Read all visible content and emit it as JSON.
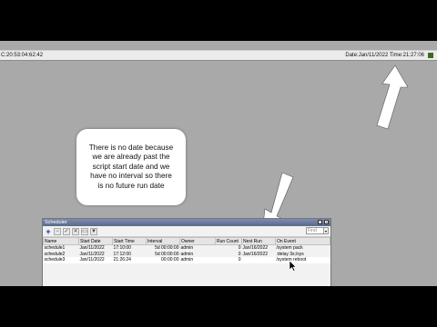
{
  "statusbar": {
    "mac": "C:20:53:04:62:42",
    "date_time": "Date:Jan/11/2022  Time:21:27:06",
    "indicator_color": "#3d6b21"
  },
  "annotation": {
    "text": "There is no date because\nwe are already past the\nscript start date and we\nhave no interval so there\nis no future run date"
  },
  "scheduler": {
    "title": "Scheduler",
    "find_placeholder": "Find",
    "columns": [
      "Name",
      "Start Date",
      "Start Time",
      "Interval",
      "Owner",
      "Run Count",
      "Next Run",
      "On Event"
    ],
    "rows": [
      [
        "schedule1",
        "Jan/11/2022",
        "17:10:00",
        "5d 00:00:00",
        "admin",
        "0",
        "Jan/16/2022",
        "/system pack"
      ],
      [
        "schedule2",
        "Jan/11/2022",
        "17:12:00",
        "5d 00:00:00",
        "admin",
        "0",
        "Jan/16/2022",
        ":delay 3s;/sys"
      ],
      [
        "schedule3",
        "Jan/11/2022",
        "21:26:24",
        "00:00:00",
        "admin",
        "0",
        "",
        "/system reboot"
      ]
    ]
  }
}
